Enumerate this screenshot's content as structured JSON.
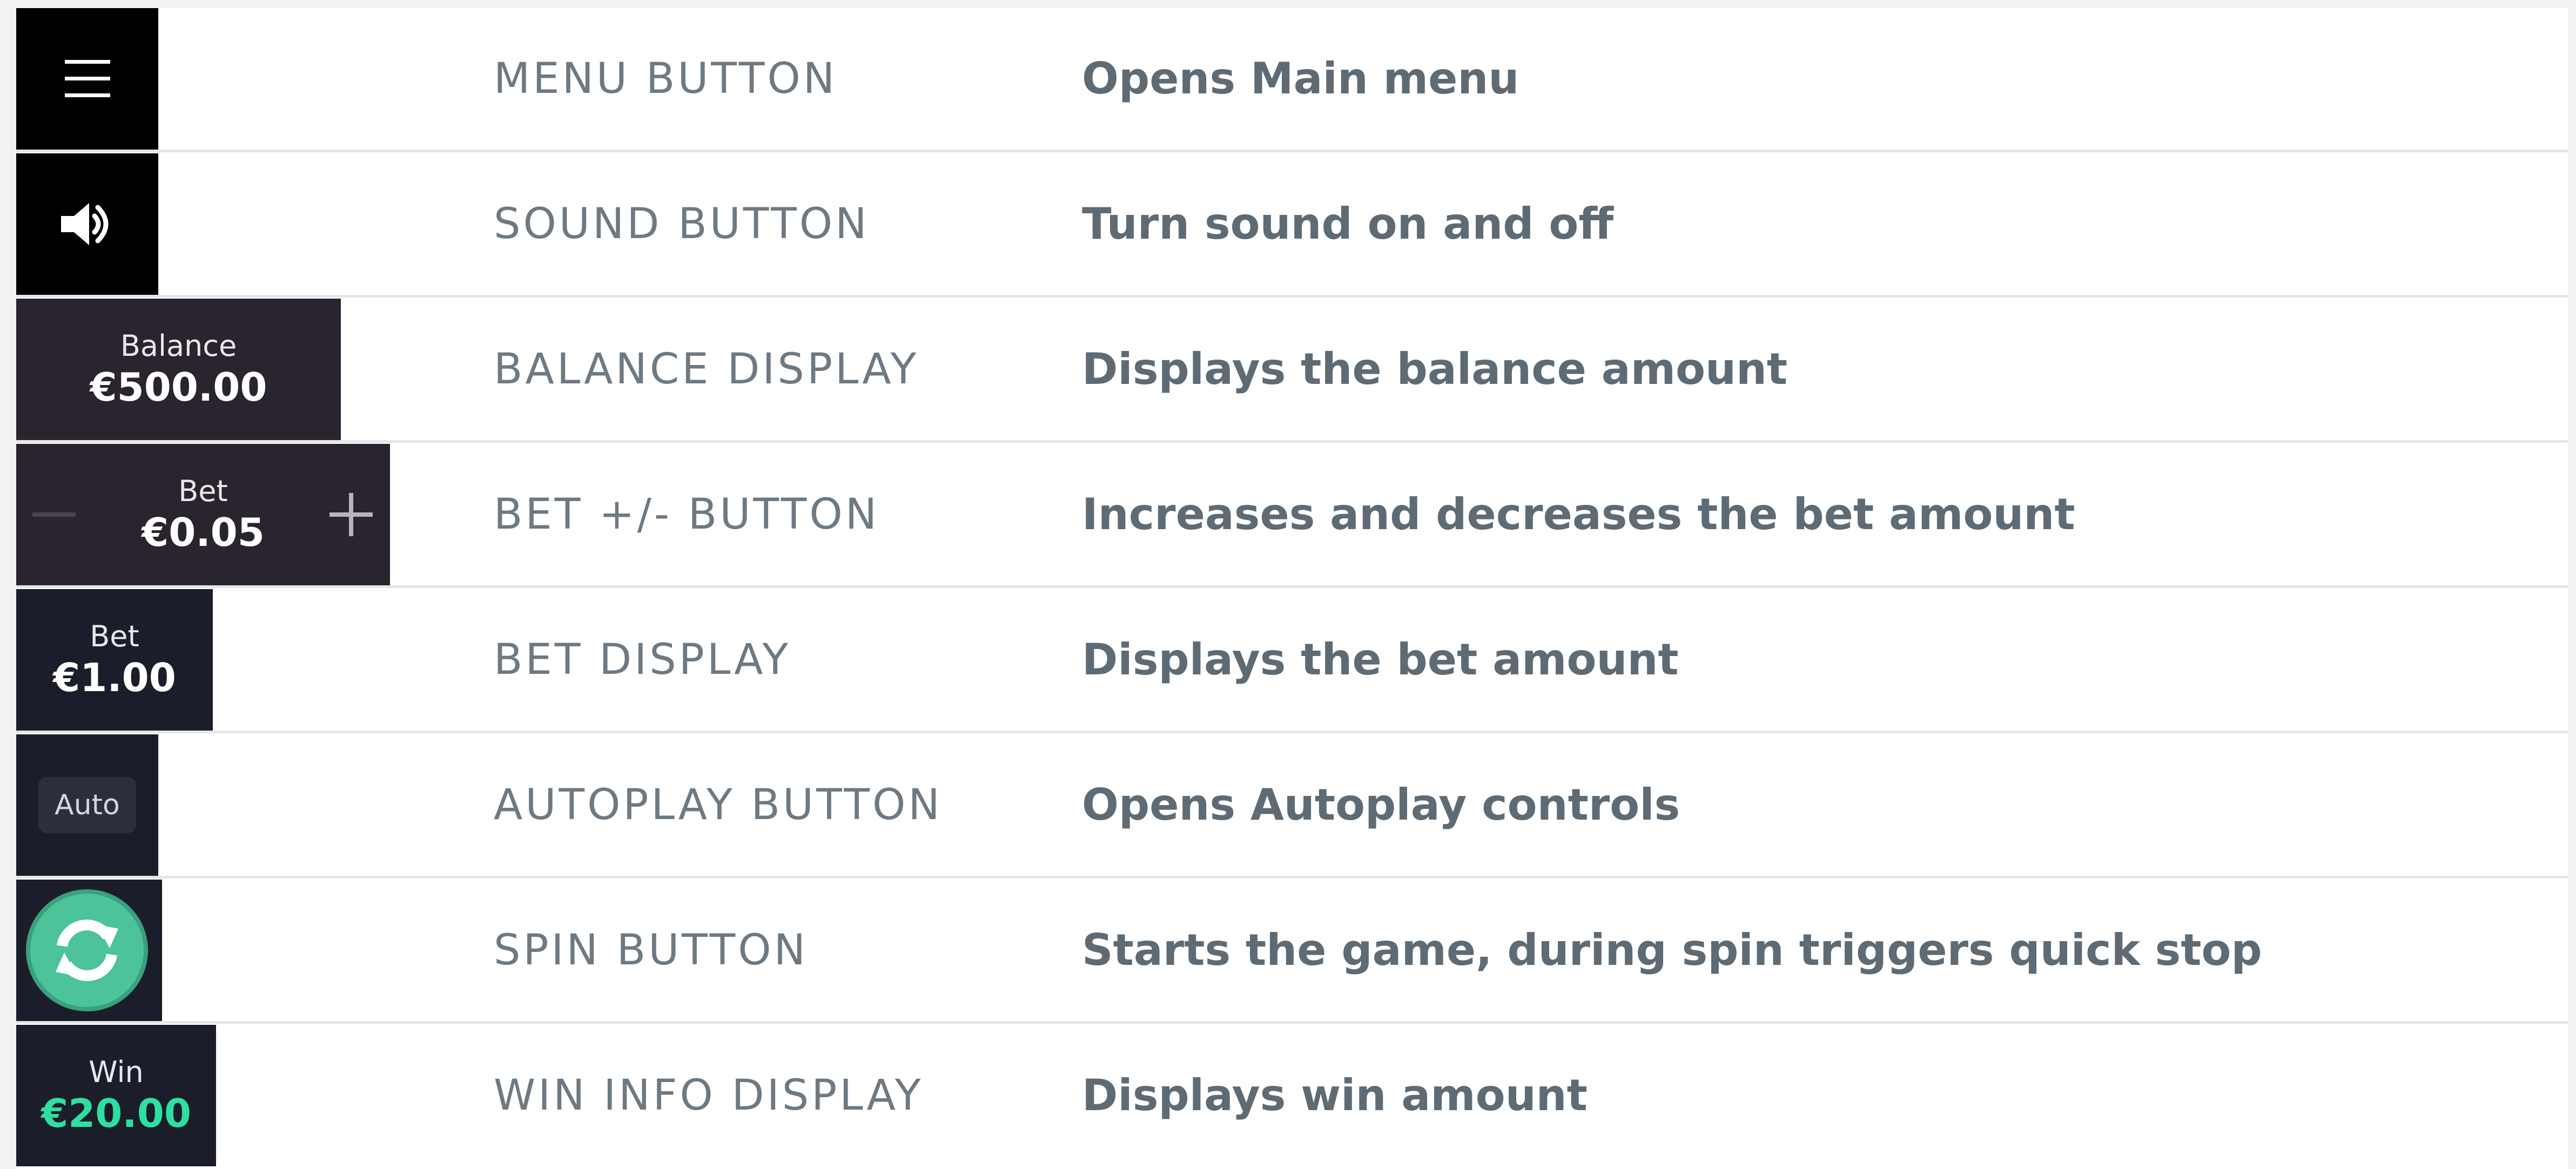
{
  "rows": [
    {
      "name": "MENU BUTTON",
      "description": "Opens Main menu",
      "icon": "hamburger-menu-icon"
    },
    {
      "name": "SOUND BUTTON",
      "description": "Turn sound on and off",
      "icon": "speaker-icon"
    },
    {
      "name": "BALANCE DISPLAY",
      "description": "Displays the balance amount",
      "label": "Balance",
      "value": "€500.00"
    },
    {
      "name": "BET +/- BUTTON",
      "description": "Increases and decreases the bet amount",
      "label": "Bet",
      "value": "€0.05",
      "minus": "−",
      "plus": "+"
    },
    {
      "name": "BET DISPLAY",
      "description": "Displays the bet amount",
      "label": "Bet",
      "value": "€1.00"
    },
    {
      "name": "AUTOPLAY BUTTON",
      "description": "Opens Autoplay controls",
      "label": "Auto"
    },
    {
      "name": "SPIN BUTTON",
      "description": "Starts the game, during spin triggers quick stop",
      "icon": "spin-refresh-icon"
    },
    {
      "name": "WIN INFO DISPLAY",
      "description": "Displays win amount",
      "label": "Win",
      "value": "€20.00"
    }
  ],
  "colors": {
    "spin_green": "#4cc39a",
    "win_green": "#2ee0a0",
    "balance_bg": "#29242d",
    "display_bg": "#1b1e2a"
  }
}
